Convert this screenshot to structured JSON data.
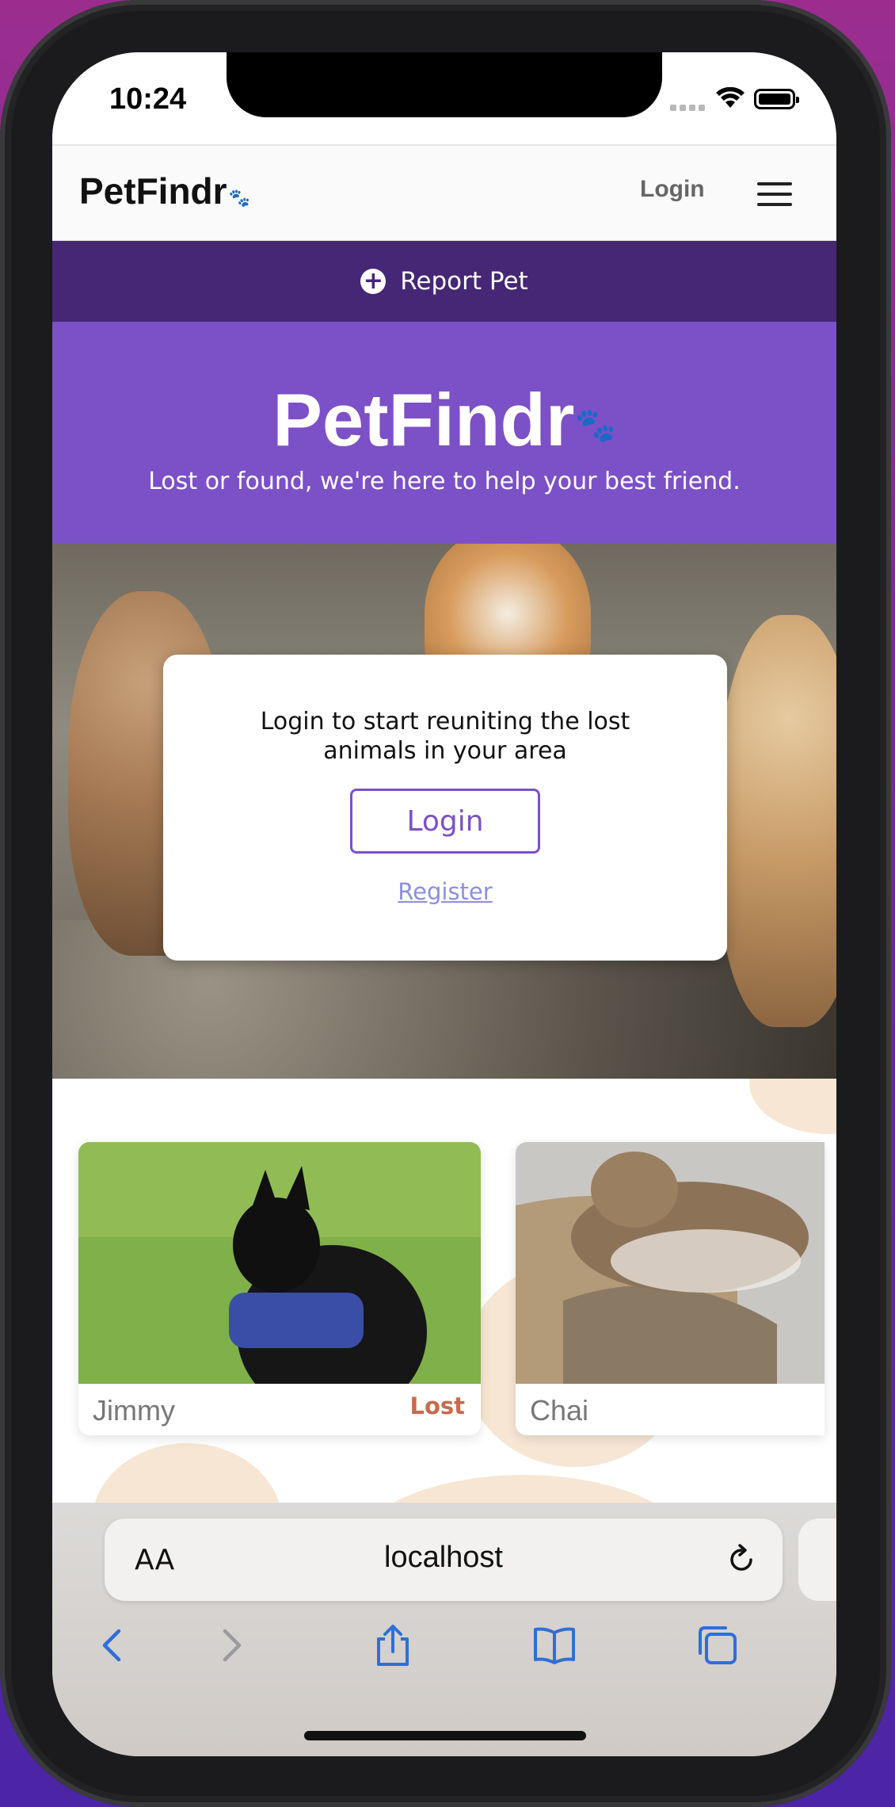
{
  "status_bar": {
    "time": "10:24"
  },
  "navbar": {
    "brand": "PetFindr",
    "login_label": "Login"
  },
  "report_bar": {
    "label": "Report Pet"
  },
  "hero": {
    "title": "PetFindr",
    "subtitle": "Lost or found, we're here to help your best friend."
  },
  "login_card": {
    "message": "Login to start reuniting the lost animals in your area",
    "login_button": "Login",
    "register_link": "Register"
  },
  "pets": [
    {
      "name": "Jimmy",
      "status": "Lost"
    },
    {
      "name": "Chai",
      "status": ""
    }
  ],
  "browser": {
    "text_size_label": "AA",
    "url": "localhost"
  },
  "colors": {
    "accent": "#7c50c7",
    "header_dark": "#452776",
    "lost": "#c86a4b",
    "ios_blue": "#2d6fd8"
  },
  "icons": [
    "paw-icon",
    "plus-circle-icon",
    "hamburger-menu-icon",
    "reload-icon",
    "back-icon",
    "forward-icon",
    "share-icon",
    "bookmarks-icon",
    "tabs-icon"
  ]
}
